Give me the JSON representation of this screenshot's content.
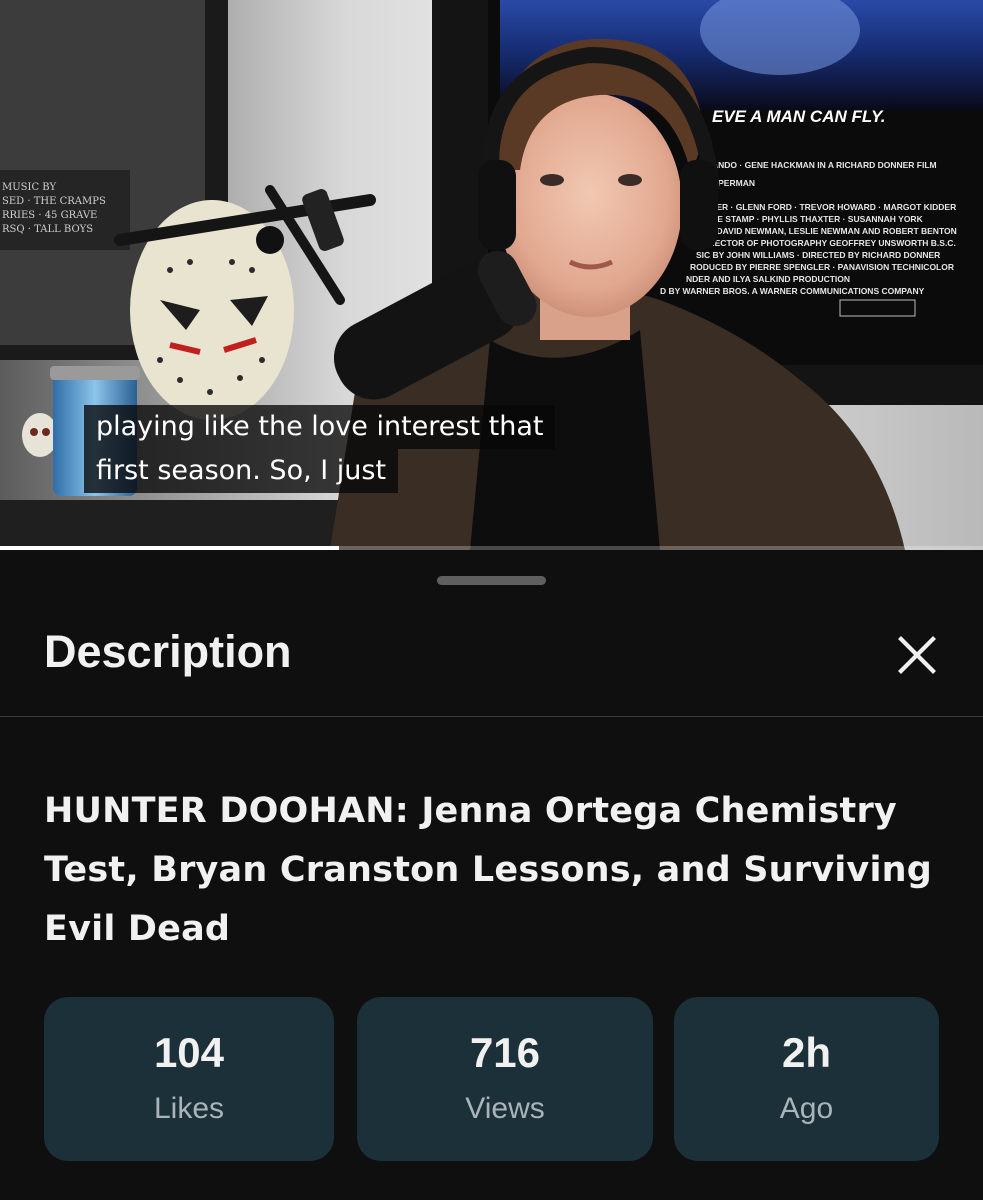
{
  "video": {
    "caption_lines": [
      "playing like the love interest that",
      "first season. So, I just"
    ],
    "progress_fraction": 0.345,
    "poster": {
      "tagline": "EVE A MAN CAN FLY.",
      "credit_lines": [
        "ANDO · GENE HACKMAN IN A RICHARD DONNER FILM",
        "UPERMAN",
        "PPER · GLENN FORD · TREVOR HOWARD · MARGOT KIDDER",
        "NCE STAMP · PHYLLIS THAXTER · SUSANNAH YORK",
        "ZO, DAVID NEWMAN, LESLIE NEWMAN AND ROBERT BENTON",
        "DIRECTOR OF PHOTOGRAPHY GEOFFREY UNSWORTH B.S.C.",
        "SIC BY JOHN WILLIAMS · DIRECTED BY RICHARD DONNER",
        "RODUCED BY PIERRE SPENGLER · PANAVISION TECHNICOLOR",
        "NDER AND ILYA SALKIND PRODUCTION",
        "D BY WARNER BROS. A WARNER COMMUNICATIONS COMPANY"
      ]
    },
    "left_poster_lines": [
      "MUSIC BY",
      "SED · THE CRAMPS",
      "RRIES · 45 GRAVE",
      "RSQ · TALL BOYS"
    ]
  },
  "sheet": {
    "title": "Description",
    "close_icon": "close-icon",
    "video_title": "HUNTER DOOHAN: Jenna Ortega Chemistry Test, Bryan Cranston Lessons, and Surviving Evil Dead",
    "stats": [
      {
        "value": "104",
        "label": "Likes"
      },
      {
        "value": "716",
        "label": "Views"
      },
      {
        "value": "2h",
        "label": "Ago"
      }
    ]
  },
  "colors": {
    "background": "#0f0f0f",
    "stat_card": "#1b3038",
    "text_primary": "#f1f1f1",
    "text_secondary": "#aab4b8"
  }
}
